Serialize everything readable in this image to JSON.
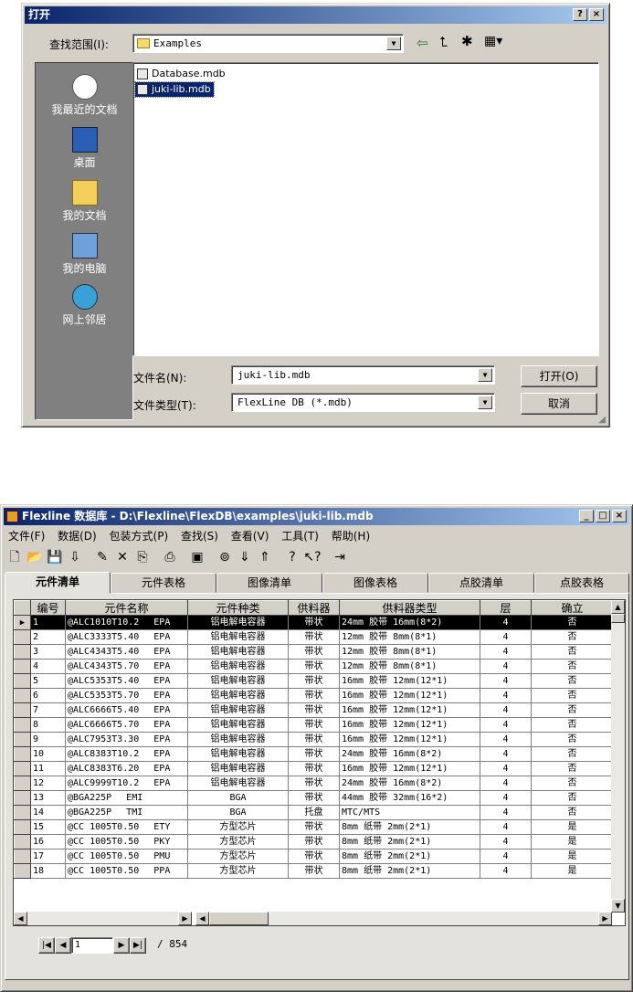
{
  "open_dialog": {
    "title": "打开",
    "help_btn": "?",
    "close_btn": "×",
    "lookin_label": "查找范围(I):",
    "lookin_value": "Examples",
    "places": [
      "我最近的文档",
      "桌面",
      "我的文档",
      "我的电脑",
      "网上邻居"
    ],
    "files": [
      "Database.mdb",
      "juki-lib.mdb"
    ],
    "filename_label": "文件名(N):",
    "filename_value": "juki-lib.mdb",
    "filetype_label": "文件类型(T):",
    "filetype_value": "FlexLine DB (*.mdb)",
    "open_button": "打开(O)",
    "cancel_button": "取消"
  },
  "main_window": {
    "title": "Flexline 数据库 - D:\\Flexline\\FlexDB\\examples\\juki-lib.mdb",
    "menu": [
      "文件(F)",
      "数据(D)",
      "包装方式(P)",
      "查找(S)",
      "查看(V)",
      "工具(T)",
      "帮助(H)"
    ],
    "tabs": [
      "元件清单",
      "元件表格",
      "图像清单",
      "图像表格",
      "点胶清单",
      "点胶表格"
    ],
    "columns": [
      "编号",
      "元件名称",
      "元件种类",
      "供料器",
      "供料器类型",
      "层",
      "确立"
    ],
    "rows": [
      [
        "1",
        "@ALC1010T10.2",
        "EPA",
        "铝电解电容器",
        "带状",
        "24mm 胶带 16mm(8*2)",
        "4",
        "否"
      ],
      [
        "2",
        "@ALC3333T5.40",
        "EPA",
        "铝电解电容器",
        "带状",
        "12mm 胶带 8mm(8*1)",
        "4",
        "否"
      ],
      [
        "3",
        "@ALC4343T5.40",
        "EPA",
        "铝电解电容器",
        "带状",
        "12mm 胶带 8mm(8*1)",
        "4",
        "否"
      ],
      [
        "4",
        "@ALC4343T5.70",
        "EPA",
        "铝电解电容器",
        "带状",
        "12mm 胶带 8mm(8*1)",
        "4",
        "否"
      ],
      [
        "5",
        "@ALC5353T5.40",
        "EPA",
        "铝电解电容器",
        "带状",
        "16mm 胶带 12mm(12*1)",
        "4",
        "否"
      ],
      [
        "6",
        "@ALC5353T5.70",
        "EPA",
        "铝电解电容器",
        "带状",
        "16mm 胶带 12mm(12*1)",
        "4",
        "否"
      ],
      [
        "7",
        "@ALC6666T5.40",
        "EPA",
        "铝电解电容器",
        "带状",
        "16mm 胶带 12mm(12*1)",
        "4",
        "否"
      ],
      [
        "8",
        "@ALC6666T5.70",
        "EPA",
        "铝电解电容器",
        "带状",
        "16mm 胶带 12mm(12*1)",
        "4",
        "否"
      ],
      [
        "9",
        "@ALC7953T3.30",
        "EPA",
        "铝电解电容器",
        "带状",
        "16mm 胶带 12mm(12*1)",
        "4",
        "否"
      ],
      [
        "10",
        "@ALC8383T10.2",
        "EPA",
        "铝电解电容器",
        "带状",
        "24mm 胶带 16mm(8*2)",
        "4",
        "否"
      ],
      [
        "11",
        "@ALC8383T6.20",
        "EPA",
        "铝电解电容器",
        "带状",
        "16mm 胶带 12mm(12*1)",
        "4",
        "否"
      ],
      [
        "12",
        "@ALC9999T10.2",
        "EPA",
        "铝电解电容器",
        "带状",
        "24mm 胶带 16mm(8*2)",
        "4",
        "否"
      ],
      [
        "13",
        "@BGA225P",
        "EMI",
        "BGA",
        "带状",
        "44mm 胶带 32mm(16*2)",
        "4",
        "否"
      ],
      [
        "14",
        "@BGA225P",
        "TMI",
        "BGA",
        "托盘",
        "MTC/MTS",
        "4",
        "否"
      ],
      [
        "15",
        "@CC 1005T0.50",
        "ETY",
        "方型芯片",
        "带状",
        "8mm 纸带 2mm(2*1)",
        "4",
        "是"
      ],
      [
        "16",
        "@CC 1005T0.50",
        "PKY",
        "方型芯片",
        "带状",
        "8mm 纸带 2mm(2*1)",
        "4",
        "是"
      ],
      [
        "17",
        "@CC 1005T0.50",
        "PMU",
        "方型芯片",
        "带状",
        "8mm 纸带 2mm(2*1)",
        "4",
        "是"
      ],
      [
        "18",
        "@CC 1005T0.50",
        "PPA",
        "方型芯片",
        "带状",
        "8mm 纸带 2mm(2*1)",
        "4",
        "是"
      ]
    ],
    "record_current": "1",
    "record_total": "/ 854"
  }
}
